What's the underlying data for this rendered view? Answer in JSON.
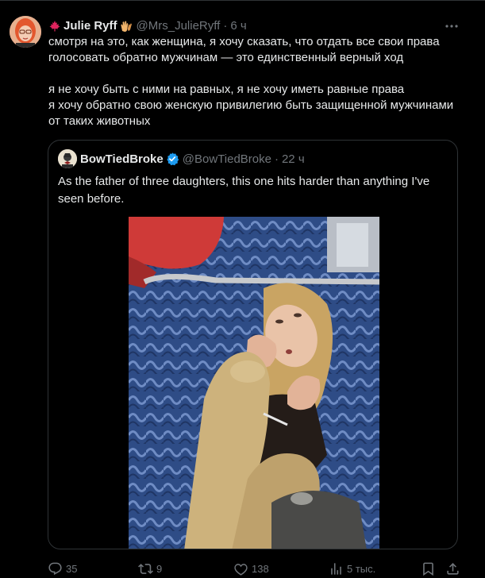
{
  "tweet": {
    "author": {
      "display_name": "Julie Ryff",
      "handle": "@Mrs_JulieRyff",
      "separator": "·",
      "time": "6 ч"
    },
    "text_lines": [
      "смотря на это, как женщина, я хочу сказать, что отдать все свои права",
      "голосовать обратно мужчинам — это единственный верный ход",
      "",
      "я не хочу быть с ними на равных, я не хочу иметь равные права",
      "я хочу обратно свою женскую привилегию быть защищенной мужчинами",
      "от таких животных"
    ]
  },
  "quoted_tweet": {
    "display_name": "BowTiedBroke",
    "handle": "@BowTiedBroke",
    "separator": "·",
    "time": "22 ч",
    "text": "As the father of three daughters, this one hits harder than anything I've seen before."
  },
  "actions": {
    "reply_count": "35",
    "retweet_count": "9",
    "like_count": "138",
    "views_count": "5 тыс."
  },
  "icons": {
    "name_prefix": "maple-leaf-icon",
    "name_suffix": "clapping-hands-icon",
    "more": "more-dots-icon",
    "verified": "verified-badge-icon",
    "reply": "reply-icon",
    "retweet": "retweet-icon",
    "like": "heart-icon",
    "views": "views-chart-icon",
    "bookmark": "bookmark-icon",
    "share": "share-icon"
  },
  "colors": {
    "background": "#000000",
    "text_primary": "#e7e9ea",
    "text_secondary": "#71767b",
    "border": "#2f3336",
    "verified_blue": "#1d9bf0",
    "maple_red": "#e0245e"
  }
}
